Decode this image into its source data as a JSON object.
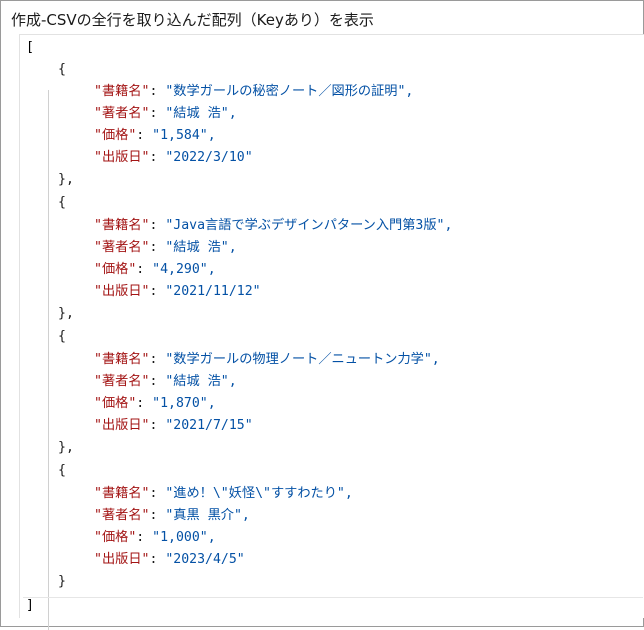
{
  "title": "作成-CSVの全行を取り込んだ配列（Keyあり）を表示",
  "open_bracket": "[",
  "close_bracket": "]",
  "records": [
    {
      "k1": "\"書籍名\"",
      "v1": "\"数学ガールの秘密ノート／図形の証明\",",
      "k2": "\"著者名\"",
      "v2": "\"結城 浩\",",
      "k3": "\"価格\"",
      "v3": "\"1,584\",",
      "k4": "\"出版日\"",
      "v4": "\"2022/3/10\"",
      "close": "},"
    },
    {
      "k1": "\"書籍名\"",
      "v1": "\"Java言語で学ぶデザインパターン入門第3版\",",
      "k2": "\"著者名\"",
      "v2": "\"結城 浩\",",
      "k3": "\"価格\"",
      "v3": "\"4,290\",",
      "k4": "\"出版日\"",
      "v4": "\"2021/11/12\"",
      "close": "},"
    },
    {
      "k1": "\"書籍名\"",
      "v1": "\"数学ガールの物理ノート／ニュートン力学\",",
      "k2": "\"著者名\"",
      "v2": "\"結城 浩\",",
      "k3": "\"価格\"",
      "v3": "\"1,870\",",
      "k4": "\"出版日\"",
      "v4": "\"2021/7/15\"",
      "close": "},"
    },
    {
      "k1": "\"書籍名\"",
      "v1": "\"進め！\\\"妖怪\\\"すすわたり\",",
      "k2": "\"著者名\"",
      "v2": "\"真黒 黒介\",",
      "k3": "\"価格\"",
      "v3": "\"1,000\",",
      "k4": "\"出版日\"",
      "v4": "\"2023/4/5\"",
      "close": "}"
    }
  ],
  "open_brace": "{",
  "colon": ": "
}
